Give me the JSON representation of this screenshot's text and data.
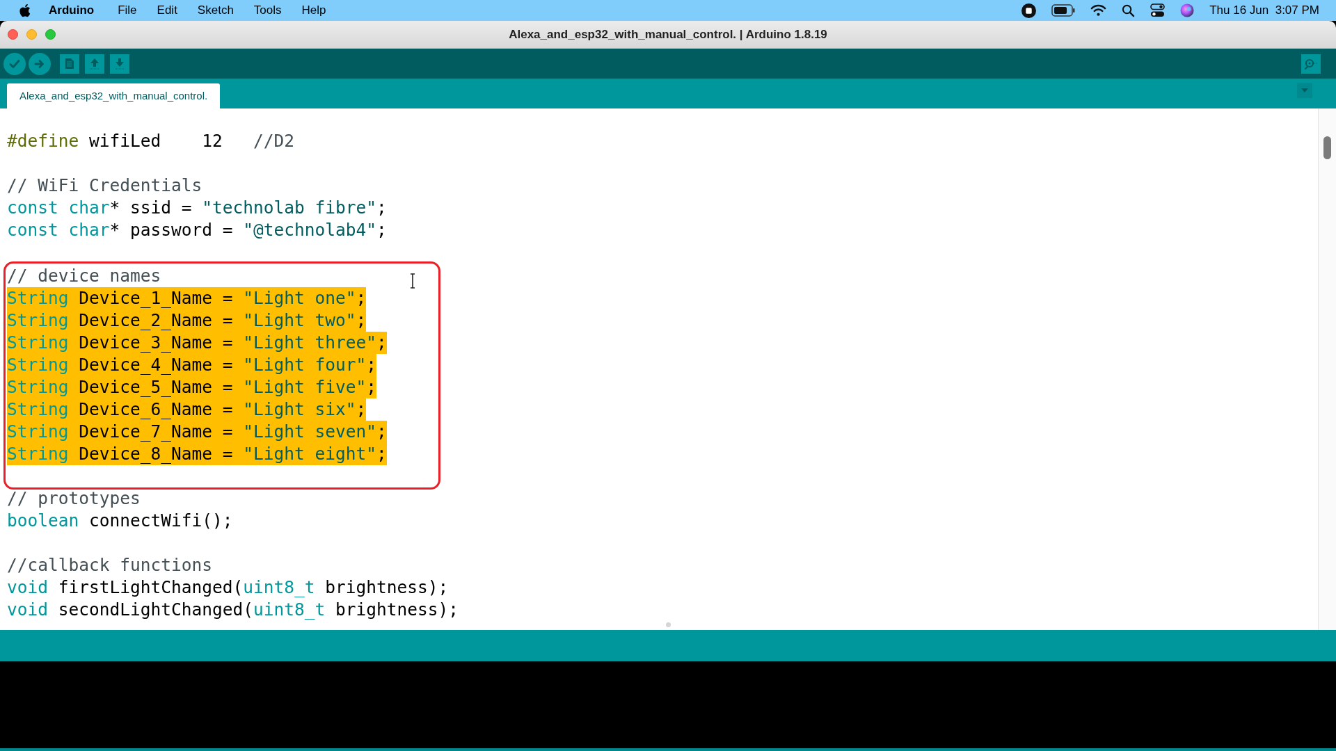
{
  "menu_bar": {
    "app_name": "Arduino",
    "items": [
      "File",
      "Edit",
      "Sketch",
      "Tools",
      "Help"
    ],
    "clock": "Thu 16 Jun  3:07 PM"
  },
  "window": {
    "title": "Alexa_and_esp32_with_manual_control. | Arduino 1.8.19"
  },
  "tabs": [
    {
      "label": "Alexa_and_esp32_with_manual_control.",
      "selected": true
    }
  ],
  "editor": {
    "blocks": [
      {
        "boxed": false,
        "lines": [
          {
            "kind": "code",
            "selected": false,
            "tokens": [
              {
                "kind": "preprocessor",
                "text": "#define"
              },
              {
                "kind": "plain",
                "text": " wifiLed    12   "
              },
              {
                "kind": "comment",
                "text": "//D2"
              }
            ]
          },
          {
            "kind": "blank"
          },
          {
            "kind": "code",
            "selected": false,
            "tokens": [
              {
                "kind": "comment",
                "text": "// WiFi Credentials"
              }
            ]
          },
          {
            "kind": "code",
            "selected": false,
            "tokens": [
              {
                "kind": "keyword",
                "text": "const char"
              },
              {
                "kind": "plain",
                "text": "* ssid = "
              },
              {
                "kind": "string",
                "text": "\"technolab fibre\""
              },
              {
                "kind": "plain",
                "text": ";"
              }
            ]
          },
          {
            "kind": "code",
            "selected": false,
            "tokens": [
              {
                "kind": "keyword",
                "text": "const char"
              },
              {
                "kind": "plain",
                "text": "* password = "
              },
              {
                "kind": "string",
                "text": "\"@technolab4\""
              },
              {
                "kind": "plain",
                "text": ";"
              }
            ]
          },
          {
            "kind": "blank"
          }
        ]
      },
      {
        "boxed": true,
        "lines": [
          {
            "kind": "code",
            "selected": false,
            "tokens": [
              {
                "kind": "comment",
                "text": "// device names"
              }
            ]
          },
          {
            "kind": "code",
            "selected": true,
            "tokens": [
              {
                "kind": "keyword",
                "text": "String"
              },
              {
                "kind": "plain",
                "text": " Device_1_Name = "
              },
              {
                "kind": "string",
                "text": "\"Light one\""
              },
              {
                "kind": "plain",
                "text": ";"
              }
            ]
          },
          {
            "kind": "code",
            "selected": true,
            "tokens": [
              {
                "kind": "keyword",
                "text": "String"
              },
              {
                "kind": "plain",
                "text": " Device_2_Name = "
              },
              {
                "kind": "string",
                "text": "\"Light two\""
              },
              {
                "kind": "plain",
                "text": ";"
              }
            ]
          },
          {
            "kind": "code",
            "selected": true,
            "tokens": [
              {
                "kind": "keyword",
                "text": "String"
              },
              {
                "kind": "plain",
                "text": " Device_3_Name = "
              },
              {
                "kind": "string",
                "text": "\"Light three\""
              },
              {
                "kind": "plain",
                "text": ";"
              }
            ]
          },
          {
            "kind": "code",
            "selected": true,
            "tokens": [
              {
                "kind": "keyword",
                "text": "String"
              },
              {
                "kind": "plain",
                "text": " Device_4_Name = "
              },
              {
                "kind": "string",
                "text": "\"Light four\""
              },
              {
                "kind": "plain",
                "text": ";"
              }
            ]
          },
          {
            "kind": "code",
            "selected": true,
            "tokens": [
              {
                "kind": "keyword",
                "text": "String"
              },
              {
                "kind": "plain",
                "text": " Device_5_Name = "
              },
              {
                "kind": "string",
                "text": "\"Light five\""
              },
              {
                "kind": "plain",
                "text": ";"
              }
            ]
          },
          {
            "kind": "code",
            "selected": true,
            "tokens": [
              {
                "kind": "keyword",
                "text": "String"
              },
              {
                "kind": "plain",
                "text": " Device_6_Name = "
              },
              {
                "kind": "string",
                "text": "\"Light six\""
              },
              {
                "kind": "plain",
                "text": ";"
              }
            ]
          },
          {
            "kind": "code",
            "selected": true,
            "tokens": [
              {
                "kind": "keyword",
                "text": "String"
              },
              {
                "kind": "plain",
                "text": " Device_7_Name = "
              },
              {
                "kind": "string",
                "text": "\"Light seven\""
              },
              {
                "kind": "plain",
                "text": ";"
              }
            ]
          },
          {
            "kind": "code",
            "selected": true,
            "tokens": [
              {
                "kind": "keyword",
                "text": "String"
              },
              {
                "kind": "plain",
                "text": " Device_8_Name = "
              },
              {
                "kind": "string",
                "text": "\"Light eight\""
              },
              {
                "kind": "plain",
                "text": ";"
              }
            ]
          },
          {
            "kind": "blank"
          }
        ]
      },
      {
        "boxed": false,
        "lines": [
          {
            "kind": "code",
            "selected": false,
            "tokens": [
              {
                "kind": "comment",
                "text": "// prototypes"
              }
            ]
          },
          {
            "kind": "code",
            "selected": false,
            "tokens": [
              {
                "kind": "keyword",
                "text": "boolean"
              },
              {
                "kind": "plain",
                "text": " connectWifi();"
              }
            ]
          },
          {
            "kind": "blank"
          },
          {
            "kind": "code",
            "selected": false,
            "tokens": [
              {
                "kind": "comment",
                "text": "//callback functions"
              }
            ]
          },
          {
            "kind": "code",
            "selected": false,
            "tokens": [
              {
                "kind": "keyword",
                "text": "void"
              },
              {
                "kind": "plain",
                "text": " firstLightChanged("
              },
              {
                "kind": "keyword",
                "text": "uint8_t"
              },
              {
                "kind": "plain",
                "text": " brightness);"
              }
            ]
          },
          {
            "kind": "code",
            "selected": false,
            "tokens": [
              {
                "kind": "keyword",
                "text": "void"
              },
              {
                "kind": "plain",
                "text": " secondLightChanged("
              },
              {
                "kind": "keyword",
                "text": "uint8_t"
              },
              {
                "kind": "plain",
                "text": " brightness);"
              }
            ]
          }
        ]
      }
    ]
  }
}
